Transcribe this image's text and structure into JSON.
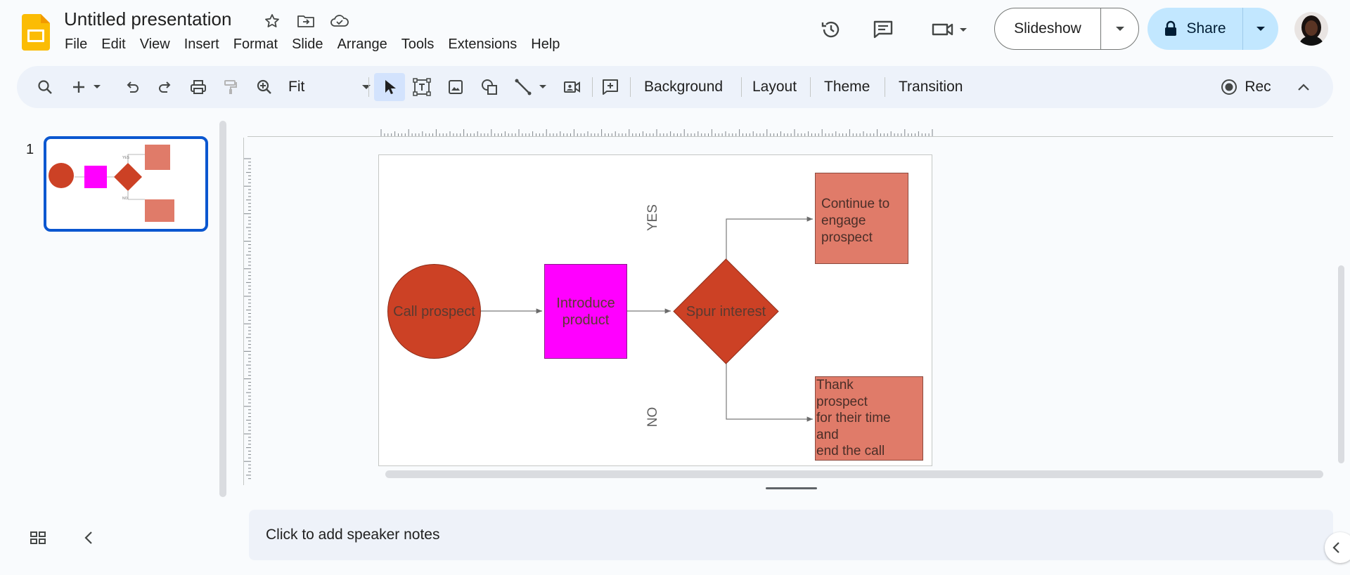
{
  "app": {
    "title": "Untitled presentation",
    "icons": [
      "star-icon",
      "move-to-folder-icon",
      "cloud-saved-icon"
    ]
  },
  "menu": [
    "File",
    "Edit",
    "View",
    "Insert",
    "Format",
    "Slide",
    "Arrange",
    "Tools",
    "Extensions",
    "Help"
  ],
  "header": {
    "slideshow_label": "Slideshow",
    "share_label": "Share"
  },
  "toolbar": {
    "zoom_value": "Fit",
    "background_label": "Background",
    "layout_label": "Layout",
    "theme_label": "Theme",
    "transition_label": "Transition",
    "rec_label": "Rec"
  },
  "filmstrip": {
    "slide_number": "1"
  },
  "slide": {
    "circle_text": "Call prospect",
    "square_text": "Introduce product",
    "square_line1": "Introduce",
    "square_line2": "product",
    "diamond_text": "Spur interest",
    "yes_label": "YES",
    "no_label": "NO",
    "top_box_lines": [
      "Continue to",
      "engage",
      "prospect"
    ],
    "bottom_box_lines": [
      "Thank",
      "prospect",
      "for their time",
      "and",
      "end the call"
    ],
    "colors": {
      "circle": "#cc4125",
      "square": "#ff00ff",
      "diamond": "#cc4125",
      "boxes": "#e07b69"
    }
  },
  "notes": {
    "placeholder": "Click to add speaker notes"
  }
}
